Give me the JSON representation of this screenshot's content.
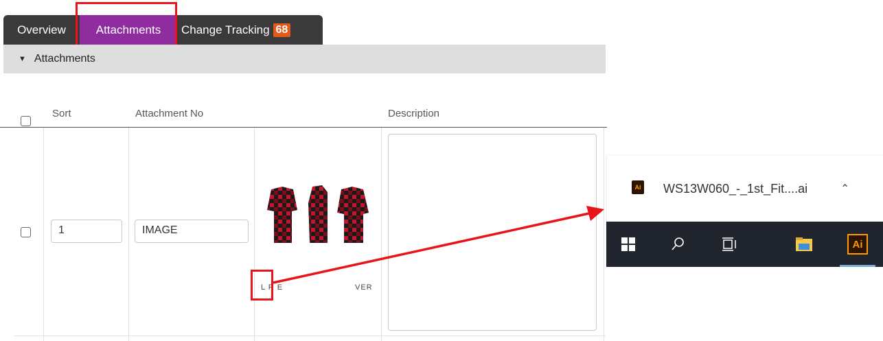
{
  "tabs": [
    {
      "label": "Overview"
    },
    {
      "label": "Attachments",
      "active": true
    },
    {
      "label": "Change Tracking",
      "badge": "68"
    }
  ],
  "section": {
    "title": "Attachments"
  },
  "table": {
    "headers": {
      "sort": "Sort",
      "attachment_no": "Attachment No",
      "description": "Description"
    },
    "row": {
      "sort": "1",
      "attachment_no": "IMAGE",
      "caption_left": "L R E",
      "caption_right": "VER",
      "description": ""
    }
  },
  "download": {
    "filename": "WS13W060_-_1st_Fit....ai",
    "icon": "illustrator-file-icon"
  },
  "taskbar": {
    "items": [
      "windows-start-icon",
      "search-icon",
      "task-view-icon",
      "file-explorer-icon",
      "illustrator-app-icon"
    ],
    "illustrator_label": "Ai"
  },
  "colors": {
    "active_tab": "#8e2ca0",
    "badge": "#e05a1a",
    "annotation_red": "#e8141c",
    "taskbar": "#20252e"
  }
}
